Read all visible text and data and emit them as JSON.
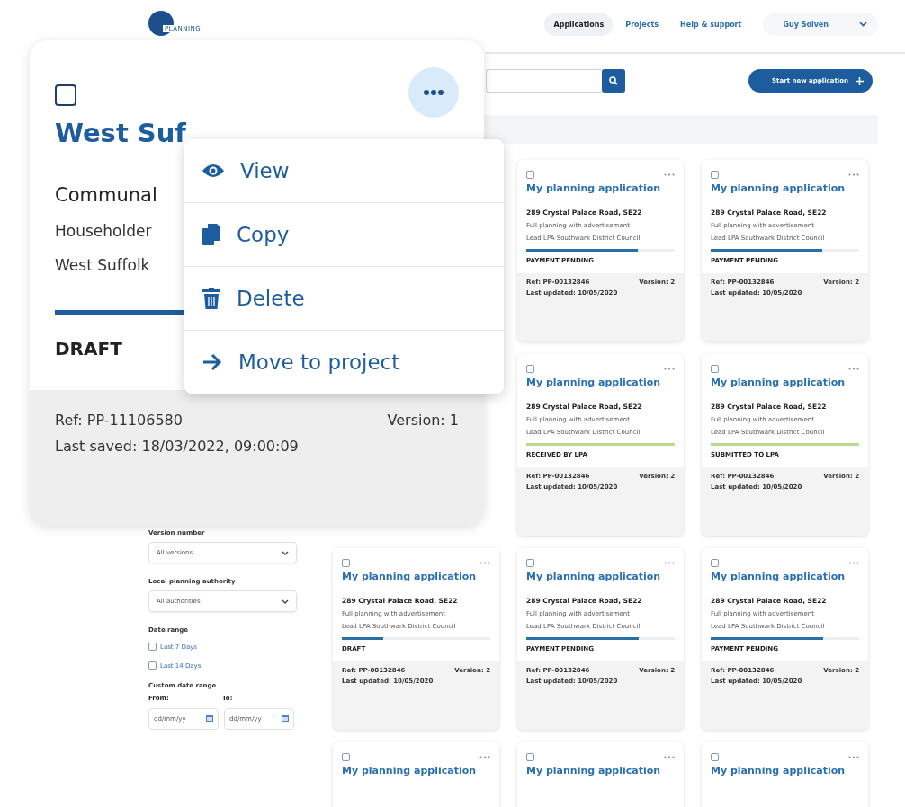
{
  "logo": {
    "text": "PLANNING"
  },
  "nav": [
    {
      "label": "Applications",
      "selected": true
    },
    {
      "label": "Projects",
      "selected": false
    },
    {
      "label": "Help & support",
      "selected": false
    }
  ],
  "user": {
    "name": "Guy Solven"
  },
  "toolbar": {
    "new_button": "Start new application"
  },
  "filters": {
    "version_label": "Version number",
    "version_value": "All versions",
    "lpa_label": "Local planning authority",
    "lpa_value": "All authorities",
    "date_label": "Date range",
    "date_options": [
      {
        "label": "Last 7 Days",
        "checked": false
      },
      {
        "label": "Last 14 Days",
        "checked": false
      }
    ],
    "custom_label": "Custom date range",
    "from_label": "From:",
    "to_label": "To:",
    "from_placeholder": "dd/mm/yy",
    "to_placeholder": "dd/mm/yy"
  },
  "grid_rows": [
    {
      "cards": [
        {
          "checked": false,
          "title": "My planning application",
          "address": "289 Crystal Palace Road, SE22",
          "type": "Full planning with advertisement",
          "lpa": "Lead LPA Southwark District Council",
          "level": 0.75,
          "color": "#2a6fa8",
          "status": "PAYMENT PENDING",
          "ref": "Ref: PP-00132846",
          "version": "Version: 2",
          "updated": "Last updated: 10/05/2020"
        },
        {
          "checked": false,
          "title": "My planning application",
          "address": "289 Crystal Palace Road, SE22",
          "type": "Full planning with advertisement",
          "lpa": "Lead LPA Southwark District Council",
          "level": 0.75,
          "color": "#2a6fa8",
          "status": "PAYMENT PENDING",
          "ref": "Ref: PP-00132846",
          "version": "Version: 2",
          "updated": "Last updated: 10/05/2020"
        }
      ]
    },
    {
      "cards": [
        {
          "checked": false,
          "title": "My planning application",
          "address": "289 Crystal Palace Road, SE22",
          "type": "Full planning with advertisement",
          "lpa": "Lead LPA Southwark District Council",
          "level": 1,
          "color": "#b8dc8c",
          "status": "RECEIVED BY LPA",
          "ref": "Ref: PP-00132846",
          "version": "Version: 2",
          "updated": "Last updated: 10/05/2020"
        },
        {
          "checked": false,
          "title": "My planning application",
          "address": "289 Crystal Palace Road, SE22",
          "type": "Full planning with advertisement",
          "lpa": "Lead LPA Southwark District Council",
          "level": 1,
          "color": "#b8dc8c",
          "status": "SUBMITTED TO LPA",
          "ref": "Ref: PP-00132846",
          "version": "Version: 2",
          "updated": "Last updated: 10/05/2020"
        }
      ]
    },
    {
      "cards": [
        {
          "checked": false,
          "title": "My planning application",
          "address": "289 Crystal Palace Road, SE22",
          "type": "Full planning with advertisement",
          "lpa": "Lead LPA Southwark District Council",
          "level": 0.28,
          "color": "#2a6fa8",
          "status": "DRAFT",
          "ref": "Ref: PP-00132846",
          "version": "Version: 2",
          "updated": "Last updated: 10/05/2020"
        },
        {
          "checked": false,
          "title": "My planning application",
          "address": "289 Crystal Palace Road, SE22",
          "type": "Full planning with advertisement",
          "lpa": "Lead LPA Southwark District Council",
          "level": 0.76,
          "color": "#2a6fa8",
          "status": "PAYMENT PENDING",
          "ref": "Ref: PP-00132846",
          "version": "Version: 2",
          "updated": "Last updated: 10/05/2020"
        },
        {
          "checked": false,
          "title": "My planning application",
          "address": "289 Crystal Palace Road, SE22",
          "type": "Full planning with advertisement",
          "lpa": "Lead LPA Southwark District Council",
          "level": 0.76,
          "color": "#2a6fa8",
          "status": "PAYMENT PENDING",
          "ref": "Ref: PP-00132846",
          "version": "Version: 2",
          "updated": "Last updated: 10/05/2020"
        }
      ]
    },
    {
      "cards": [
        {
          "checked": false,
          "title": "My planning application"
        },
        {
          "checked": false,
          "title": "My planning application"
        },
        {
          "checked": false,
          "title": "My planning application"
        }
      ]
    }
  ],
  "focus_card": {
    "checked": false,
    "title": "West Suf",
    "category": "Communal",
    "type": "Householder",
    "lpa": "West Suffolk",
    "level": 0.32,
    "status": "DRAFT",
    "ref": "Ref: PP-11106580",
    "version": "Version: 1",
    "saved": "Last saved: 18/03/2022, 09:00:09"
  },
  "menu": [
    {
      "kind": "view",
      "label": "View"
    },
    {
      "kind": "copy",
      "label": "Copy"
    },
    {
      "kind": "delete",
      "label": "Delete"
    },
    {
      "kind": "move",
      "label": "Move to project"
    }
  ]
}
